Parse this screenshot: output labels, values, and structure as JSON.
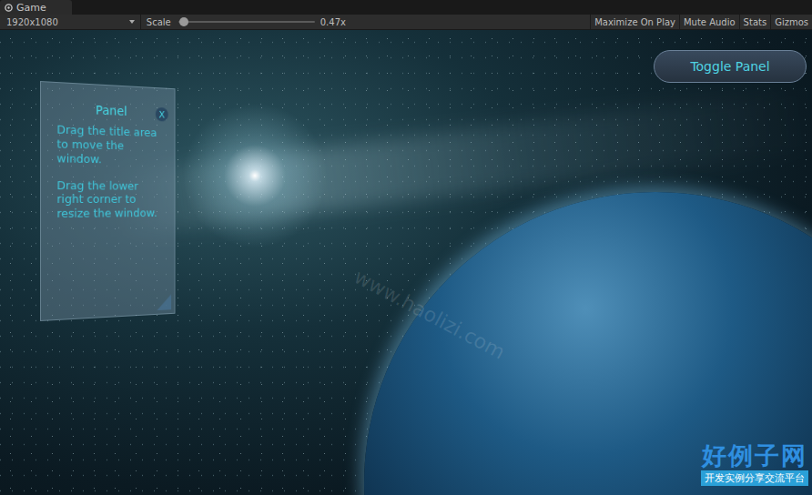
{
  "window": {
    "tab": "Game"
  },
  "toolbar": {
    "resolution": "1920x1080",
    "scale_label": "Scale",
    "scale": {
      "level": 0.03,
      "reading": "0.47x"
    },
    "buttons": [
      "Maximize On Play",
      "Mute Audio",
      "Stats",
      "Gizmos"
    ]
  },
  "panel": {
    "title": "Panel",
    "close": "X",
    "paragraphs": [
      "Drag the title area to move the window.",
      "Drag the lower right corner to resize the window."
    ]
  },
  "toggle_button": "Toggle Panel",
  "watermark": {
    "logo": "好例子网",
    "tagline": "开发实例分享交流平台",
    "url": "www.haolizi.com"
  }
}
